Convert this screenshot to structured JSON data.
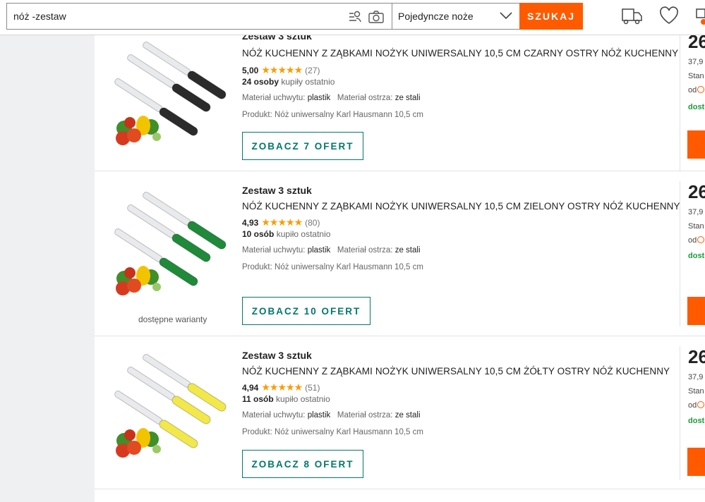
{
  "search": {
    "query": "nóż -zestaw"
  },
  "category": {
    "selected": "Pojedyncze noże"
  },
  "search_button": {
    "label": "SZUKAJ"
  },
  "offers": [
    {
      "tag": "Zestaw 3 sztuk",
      "title": "NÓŻ KUCHENNY Z ZĄBKAMI NOŻYK UNIWERSALNY 10,5 CM CZARNY OSTRY NÓŻ KUCHENNY",
      "rating": "5,00",
      "stars": "★★★★★",
      "rating_count": "(27)",
      "bought_count": "24 osoby",
      "bought_text": "kupiły ostatnio",
      "param1_label": "Materiał uchwytu:",
      "param1_value": "plastik",
      "param2_label": "Materiał ostrza:",
      "param2_value": "ze stali",
      "product_label": "Produkt:",
      "product_value": "Nóż uniwersalny Karl Hausmann 10,5 cm",
      "offers_button": "ZOBACZ 7 OFERT",
      "handle_color": "#2b2b2b",
      "price_big": "26",
      "price_old": "37,9",
      "price_std": "Stan",
      "price_od": "od",
      "price_dost": "dost"
    },
    {
      "tag": "Zestaw 3 sztuk",
      "title": "NÓŻ KUCHENNY Z ZĄBKAMI NOŻYK UNIWERSALNY 10,5 CM ZIELONY OSTRY NÓŻ KUCHENNY",
      "rating": "4,93",
      "stars": "★★★★★",
      "rating_count": "(80)",
      "bought_count": "10 osób",
      "bought_text": "kupiło ostatnio",
      "param1_label": "Materiał uchwytu:",
      "param1_value": "plastik",
      "param2_label": "Materiał ostrza:",
      "param2_value": "ze stali",
      "product_label": "Produkt:",
      "product_value": "Nóż uniwersalny Karl Hausmann 10,5 cm",
      "offers_button": "ZOBACZ 10 OFERT",
      "variants": "dostępne warianty",
      "handle_color": "#1f8a3a",
      "price_big": "26",
      "price_old": "37,9",
      "price_std": "Stan",
      "price_od": "od",
      "price_dost": "dost"
    },
    {
      "tag": "Zestaw 3 sztuk",
      "title": "NÓŻ KUCHENNY Z ZĄBKAMI NOŻYK UNIWERSALNY 10,5 CM ŻÓŁTY OSTRY NÓŻ KUCHENNY",
      "rating": "4,94",
      "stars": "★★★★★",
      "rating_count": "(51)",
      "bought_count": "11 osób",
      "bought_text": "kupiło ostatnio",
      "param1_label": "Materiał uchwytu:",
      "param1_value": "plastik",
      "param2_label": "Materiał ostrza:",
      "param2_value": "ze stali",
      "product_label": "Produkt:",
      "product_value": "Nóż uniwersalny Karl Hausmann 10,5 cm",
      "offers_button": "ZOBACZ 8 OFERT",
      "handle_color": "#f2e84a",
      "price_big": "26",
      "price_old": "37,9",
      "price_std": "Stan",
      "price_od": "od",
      "price_dost": "dost"
    }
  ],
  "colors": {
    "accent": "#ff5a00",
    "teal": "#00796b",
    "available": "#1a9b3a",
    "star": "#ff9a00"
  }
}
